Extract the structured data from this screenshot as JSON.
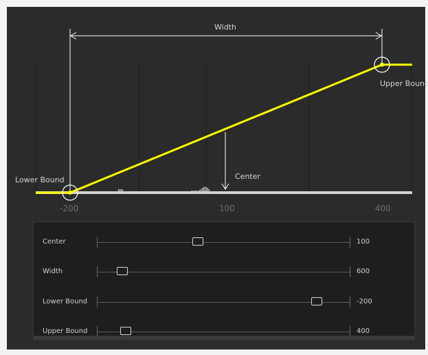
{
  "graph": {
    "width_label": "Width",
    "center_label": "Center",
    "lower_bound_label": "Lower Bound",
    "upper_bound_label": "Upper Bound",
    "ticks": [
      "-200",
      "100",
      "400"
    ],
    "line_color": "#ffff00",
    "annotation_color": "#ffffff"
  },
  "controls": {
    "sliders": [
      {
        "label": "Center",
        "value": "100",
        "fraction": 0.4
      },
      {
        "label": "Width",
        "value": "600",
        "fraction": 0.1
      },
      {
        "label": "Lower Bound",
        "value": "-200",
        "fraction": 0.87
      },
      {
        "label": "Upper Bound",
        "value": "400",
        "fraction": 0.115
      }
    ]
  }
}
